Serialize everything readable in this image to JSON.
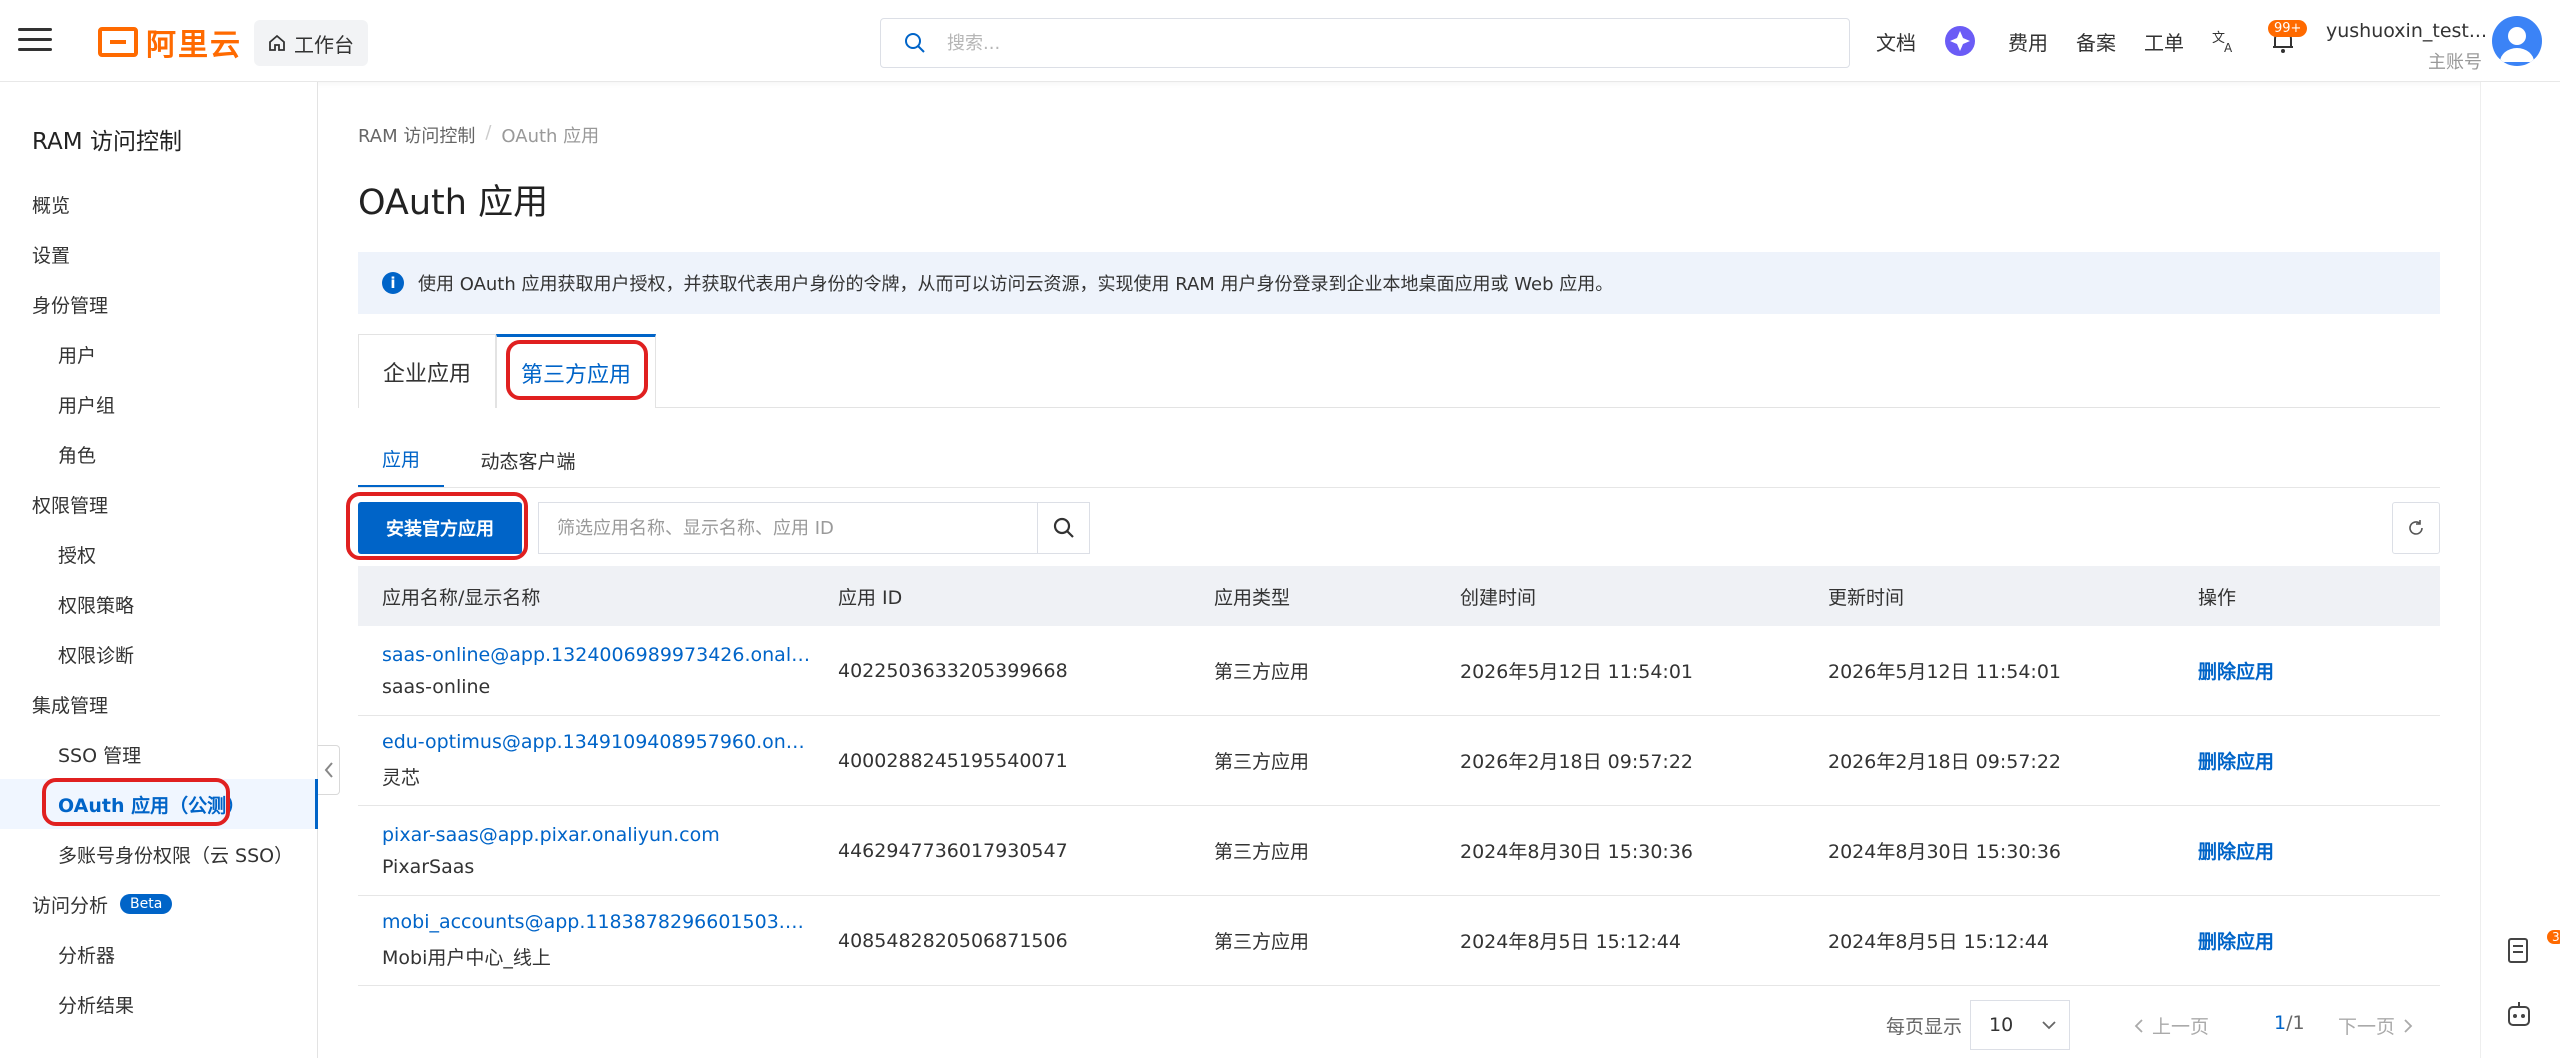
{
  "header": {
    "logo_text": "阿里云",
    "workbench": "工作台",
    "search_placeholder": "搜索...",
    "nav": {
      "docs": "文档",
      "fees": "费用",
      "filing": "备案",
      "ticket": "工单"
    },
    "notif_count": "99+",
    "user_name": "yushuoxin_test...",
    "user_role": "主账号"
  },
  "sidebar": {
    "title": "RAM 访问控制",
    "items": [
      {
        "label": "概览"
      },
      {
        "label": "设置"
      },
      {
        "label": "身份管理"
      },
      {
        "label": "用户"
      },
      {
        "label": "用户组"
      },
      {
        "label": "角色"
      },
      {
        "label": "权限管理"
      },
      {
        "label": "授权"
      },
      {
        "label": "权限策略"
      },
      {
        "label": "权限诊断"
      },
      {
        "label": "集成管理"
      },
      {
        "label": "SSO 管理"
      },
      {
        "label": "OAuth 应用（公测）"
      },
      {
        "label": "多账号身份权限（云 SSO）"
      },
      {
        "label": "访问分析"
      },
      {
        "label": "分析器"
      },
      {
        "label": "分析结果"
      }
    ],
    "beta": "Beta"
  },
  "breadcrumb": {
    "root": "RAM 访问控制",
    "sep": "/",
    "current": "OAuth 应用"
  },
  "page_title": "OAuth 应用",
  "info": "使用 OAuth 应用获取用户授权，并获取代表用户身份的令牌，从而可以访问云资源，实现使用 RAM 用户身份登录到企业本地桌面应用或 Web 应用。",
  "tabs": {
    "enterprise": "企业应用",
    "third_party": "第三方应用"
  },
  "subtabs": {
    "app": "应用",
    "dynamic_client": "动态客户端"
  },
  "toolbar": {
    "install_btn": "安装官方应用",
    "filter_placeholder": "筛选应用名称、显示名称、应用 ID"
  },
  "table": {
    "headers": {
      "name": "应用名称/显示名称",
      "app_id": "应用 ID",
      "type": "应用类型",
      "created": "创建时间",
      "updated": "更新时间",
      "action": "操作"
    },
    "rows": [
      {
        "name": "saas-online@app.1324006989973426.onaliyu...",
        "display": "saas-online",
        "app_id": "4022503633205399668",
        "type": "第三方应用",
        "created": "2026年5月12日 11:54:01",
        "updated": "2026年5月12日 11:54:01",
        "action": "删除应用"
      },
      {
        "name": "edu-optimus@app.1349109408957960.onaliy...",
        "display": "灵芯",
        "app_id": "4000288245195540071",
        "type": "第三方应用",
        "created": "2026年2月18日 09:57:22",
        "updated": "2026年2月18日 09:57:22",
        "action": "删除应用"
      },
      {
        "name": "pixar-saas@app.pixar.onaliyun.com",
        "display": "PixarSaas",
        "app_id": "4462947736017930547",
        "type": "第三方应用",
        "created": "2024年8月30日 15:30:36",
        "updated": "2024年8月30日 15:30:36",
        "action": "删除应用"
      },
      {
        "name": "mobi_accounts@app.1183878296601503.onal...",
        "display": "Mobi用户中心_线上",
        "app_id": "4085482820506871506",
        "type": "第三方应用",
        "created": "2024年8月5日 15:12:44",
        "updated": "2024年8月5日 15:12:44",
        "action": "删除应用"
      }
    ]
  },
  "pagination": {
    "per_page_label": "每页显示",
    "per_page": "10",
    "prev": "上一页",
    "current": "1",
    "total": "/1",
    "next": "下一页"
  },
  "rail": {
    "badge": "3"
  }
}
